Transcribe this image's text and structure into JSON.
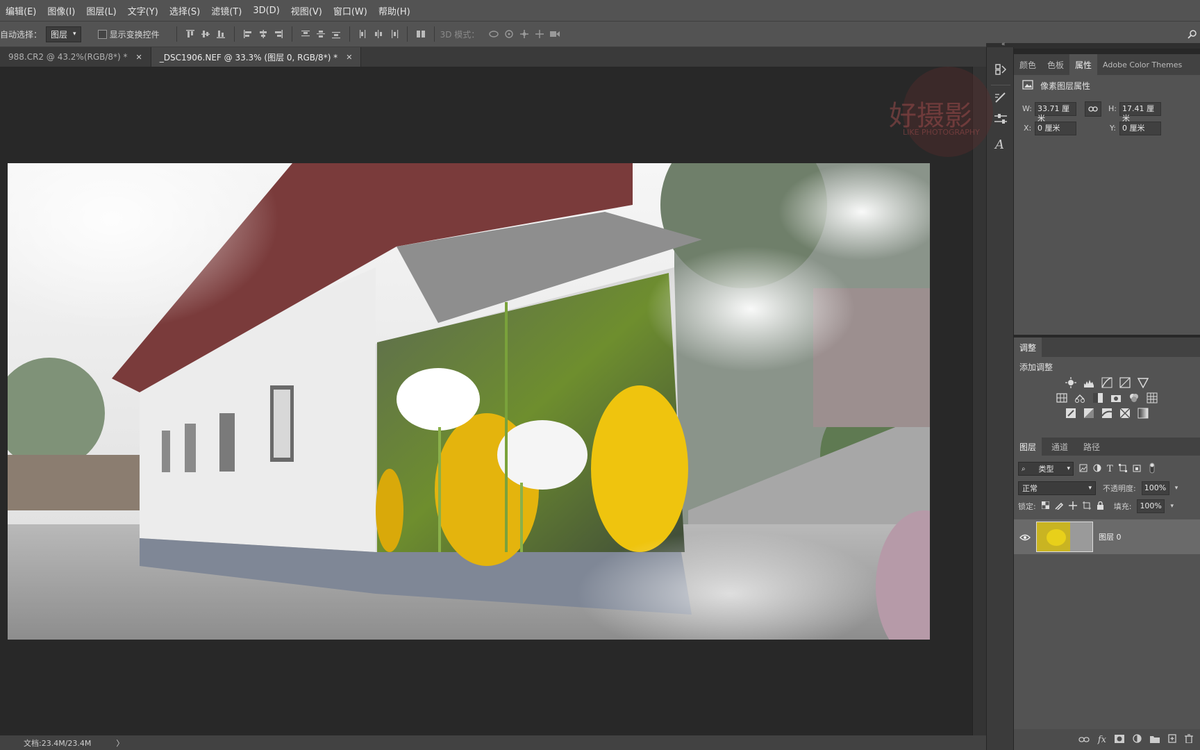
{
  "menu": [
    "编辑(E)",
    "图像(I)",
    "图层(L)",
    "文字(Y)",
    "选择(S)",
    "滤镜(T)",
    "3D(D)",
    "视图(V)",
    "窗口(W)",
    "帮助(H)"
  ],
  "options": {
    "auto_select_label": "自动选择：",
    "auto_select_value": "图层",
    "transform_label": "显示变换控件",
    "mode3d_label": "3D 模式："
  },
  "tabs": [
    {
      "label": "988.CR2 @ 43.2%(RGB/8*) *",
      "active": false
    },
    {
      "label": "_DSC1906.NEF @ 33.3% (图层 0, RGB/8*) *",
      "active": true
    }
  ],
  "status": {
    "doc": "文档:23.4M/23.4M",
    "arrow": "〉"
  },
  "properties": {
    "tabs": [
      "颜色",
      "色板",
      "属性",
      "Adobe Color Themes"
    ],
    "active_tab": "属性",
    "title": "像素图层属性",
    "w_label": "W:",
    "w_value": "33.71 厘米",
    "h_label": "H:",
    "h_value": "17.41 厘米",
    "x_label": "X:",
    "x_value": "0 厘米",
    "y_label": "Y:",
    "y_value": "0 厘米"
  },
  "adjustments": {
    "tab": "调整",
    "add_label": "添加调整"
  },
  "layers": {
    "tabs": [
      "图层",
      "通道",
      "路径"
    ],
    "kind_filter": "类型",
    "blend_mode": "正常",
    "opacity_label": "不透明度:",
    "opacity_value": "100%",
    "lock_label": "锁定:",
    "fill_label": "填充:",
    "fill_value": "100%",
    "items": [
      {
        "name": "图层 0",
        "visible": true
      }
    ]
  },
  "watermark": {
    "title": "好摄影",
    "subtitle": "LIKE PHOTOGRAPHY"
  },
  "colors": {
    "accent": "#535353",
    "canvas": "#282828",
    "panel": "#535353"
  }
}
